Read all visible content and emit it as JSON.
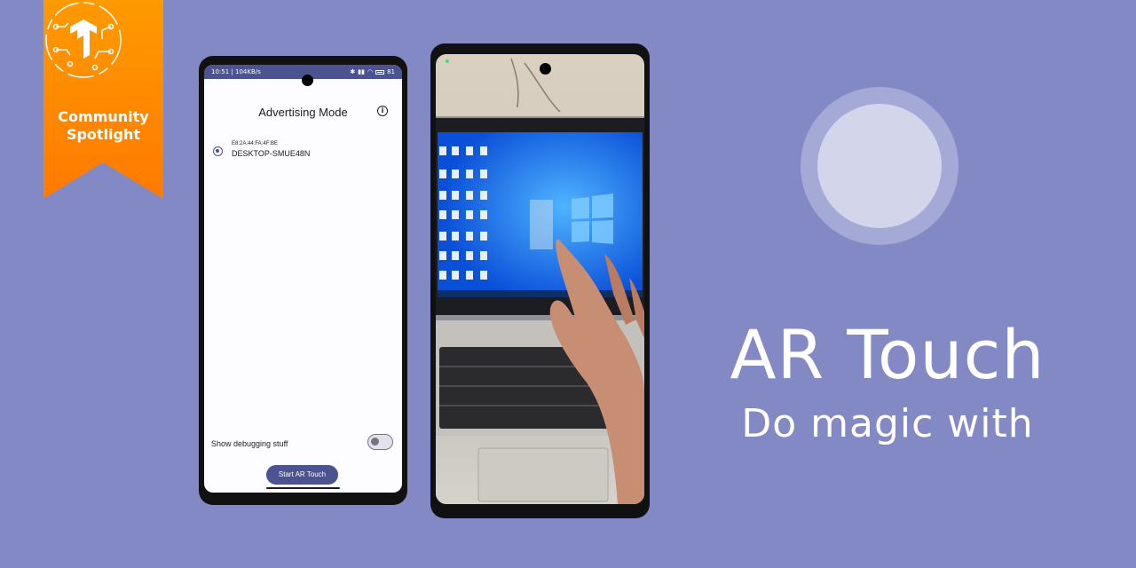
{
  "ribbon": {
    "line1": "Community",
    "line2": "Spotlight",
    "color": "#ff8c00"
  },
  "phone_app": {
    "status": {
      "time": "10:51",
      "speed": "104KB/s",
      "battery": "81"
    },
    "title": "Advertising Mode",
    "device": {
      "mac": "E8:2A:44:FA:4F:BE",
      "name": "DESKTOP-SMUE48N"
    },
    "debug_label": "Show debugging stuff",
    "start_button": "Start AR Touch",
    "accent": "#4b5490"
  },
  "hero": {
    "title": "AR Touch",
    "subtitle": "Do magic with"
  }
}
